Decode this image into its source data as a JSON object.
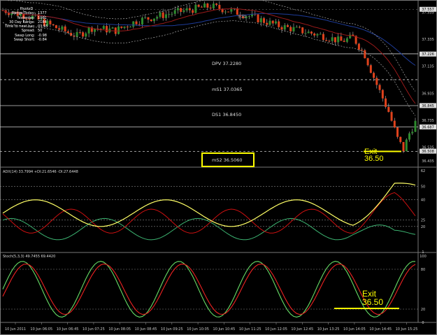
{
  "info_box": {
    "title": "PivotsD",
    "rows": [
      {
        "label": "Range  Today:",
        "value": "1377"
      },
      {
        "label": "Yesterday:",
        "value": "1061"
      },
      {
        "label": "30 Day Range:",
        "value": "2184"
      },
      {
        "label": "Time to next bar:",
        "value": "03:55"
      },
      {
        "label": "Spread:",
        "value": "50"
      },
      {
        "label": "Swap  Long:",
        "value": "-0.98"
      },
      {
        "label": "Swap  Short:",
        "value": "-0.84"
      }
    ]
  },
  "price_panel": {
    "price_labels": [
      "37.557",
      "37.535",
      "37.335",
      "37.226",
      "37.135",
      "36.935",
      "36.845",
      "36.735",
      "36.687",
      "36.535",
      "36.508",
      "36.435"
    ],
    "levels": [
      {
        "label": "DPV  37.2280",
        "price": 37.228
      },
      {
        "label": "mS1  37.0365",
        "price": 37.0365
      },
      {
        "label": "DS1  36.8450",
        "price": 36.845
      },
      {
        "label": "mS2  36.5060",
        "price": 36.506
      }
    ],
    "partial_label": "570",
    "exit_label": {
      "line1": "Exit",
      "line2": "36.50"
    }
  },
  "adx_panel": {
    "header": "ADX(14) 33.7994 +DI:21.6546 -DI:27.6448",
    "scale_labels": [
      "62",
      "50",
      "40",
      "25",
      "20",
      "1"
    ]
  },
  "stoch_panel": {
    "header": "Stoch(5,3,3) 49.7455 69.4420",
    "scale_labels": [
      "100",
      "80",
      "20",
      "0"
    ],
    "exit_label": {
      "line1": "Exit",
      "line2": "36.50"
    }
  },
  "time_axis": [
    "10 Jun 2011",
    "10 Jun 06:05",
    "10 Jun 06:45",
    "10 Jun 07:25",
    "10 Jun 08:05",
    "10 Jun 08:45",
    "10 Jun 09:25",
    "10 Jun 10:05",
    "10 Jun 10:45",
    "10 Jun 11:25",
    "10 Jun 12:05",
    "10 Jun 12:45",
    "10 Jun 13:25",
    "10 Jun 14:05",
    "10 Jun 14:45",
    "10 Jun 15:25"
  ],
  "colors": {
    "background": "#000000",
    "bull_candle": "#2e8b2e",
    "bear_candle": "#e0421c",
    "adx_line": "#ffff66",
    "plus_di": "#3cb371",
    "minus_di": "#cc1010",
    "stoch_main": "#66dd66",
    "stoch_signal": "#ee2222",
    "highlight": "#ffff00"
  }
}
